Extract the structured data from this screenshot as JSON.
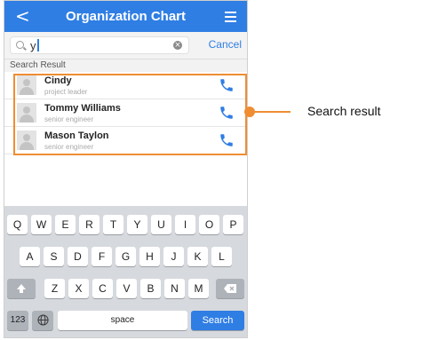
{
  "nav": {
    "back_glyph": "<",
    "title": "Organization Chart",
    "menu_icon": "hamburger-menu-icon"
  },
  "search": {
    "value": "y",
    "cancel_label": "Cancel"
  },
  "section_header": "Search Result",
  "results": [
    {
      "name": "Cindy",
      "role": "project leader"
    },
    {
      "name": "Tommy Williams",
      "role": "senior engineer"
    },
    {
      "name": "Mason Taylon",
      "role": "senior engineer"
    }
  ],
  "keyboard": {
    "row1": [
      "Q",
      "W",
      "E",
      "R",
      "T",
      "Y",
      "U",
      "I",
      "O",
      "P"
    ],
    "row2": [
      "A",
      "S",
      "D",
      "F",
      "G",
      "H",
      "J",
      "K",
      "L"
    ],
    "row3": [
      "Z",
      "X",
      "C",
      "V",
      "B",
      "N",
      "M"
    ],
    "numbers_label": "123",
    "space_label": "space",
    "search_label": "Search"
  },
  "callout": {
    "label": "Search result"
  },
  "colors": {
    "accent": "#2f7ee4",
    "highlight": "#ef8d33"
  }
}
